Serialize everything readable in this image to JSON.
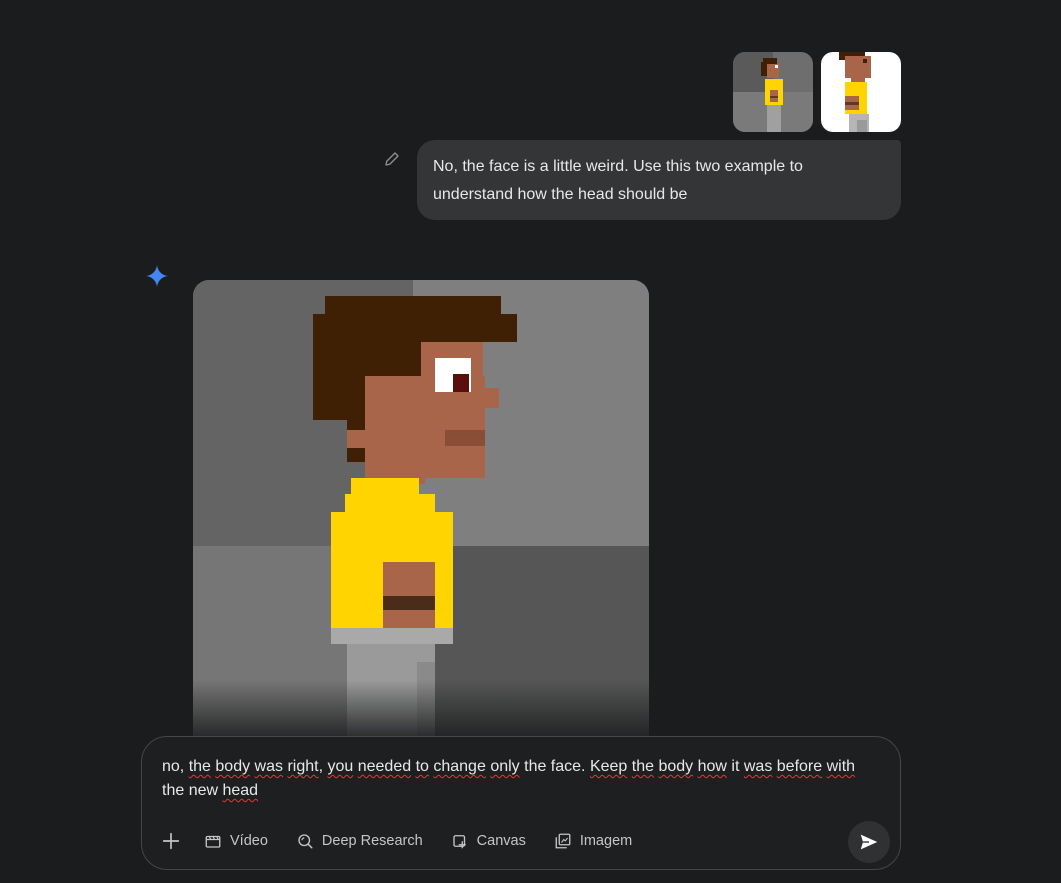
{
  "attachments": [
    {
      "name": "attachment-thumbnail-1"
    },
    {
      "name": "attachment-thumbnail-2"
    }
  ],
  "user_message": {
    "line1": "No, the face is a little weird. Use this two example to",
    "line2": "understand how the head should be"
  },
  "input": {
    "segments": [
      {
        "t": "no, "
      },
      {
        "t": "the",
        "err": true
      },
      {
        "t": " "
      },
      {
        "t": "body",
        "err": true
      },
      {
        "t": " "
      },
      {
        "t": "was",
        "err": true
      },
      {
        "t": " "
      },
      {
        "t": "right",
        "err": true
      },
      {
        "t": ", "
      },
      {
        "t": "you",
        "err": true
      },
      {
        "t": " "
      },
      {
        "t": "needed",
        "err": true
      },
      {
        "t": " "
      },
      {
        "t": "to",
        "err": true
      },
      {
        "t": " "
      },
      {
        "t": "change",
        "err": true
      },
      {
        "t": " "
      },
      {
        "t": "only",
        "err": true
      },
      {
        "t": " the face. "
      },
      {
        "t": "Keep",
        "err": true
      },
      {
        "t": " "
      },
      {
        "t": "the",
        "err": true
      },
      {
        "t": " "
      },
      {
        "t": "body",
        "err": true
      },
      {
        "t": " "
      },
      {
        "t": "how",
        "err": true
      },
      {
        "t": " it "
      },
      {
        "t": "was",
        "err": true
      },
      {
        "t": " "
      },
      {
        "t": "before",
        "err": true
      },
      {
        "t": " "
      },
      {
        "t": "with",
        "err": true
      },
      {
        "t": " the new "
      },
      {
        "t": "head",
        "err": true
      }
    ]
  },
  "toolbar": {
    "video_label": "Vídeo",
    "deep_research_label": "Deep Research",
    "canvas_label": "Canvas",
    "image_label": "Imagem"
  },
  "colors": {
    "background": "#1b1c1d",
    "bubble": "#333537",
    "accent_blue": "#4285f4",
    "shirt_yellow": "#ffd400",
    "skin": "#a9654a",
    "hair": "#3f2005"
  },
  "icons": [
    "pencil-icon",
    "gemini-spark-icon",
    "plus-icon",
    "video-icon",
    "deep-research-icon",
    "canvas-icon",
    "image-icon",
    "send-icon"
  ]
}
